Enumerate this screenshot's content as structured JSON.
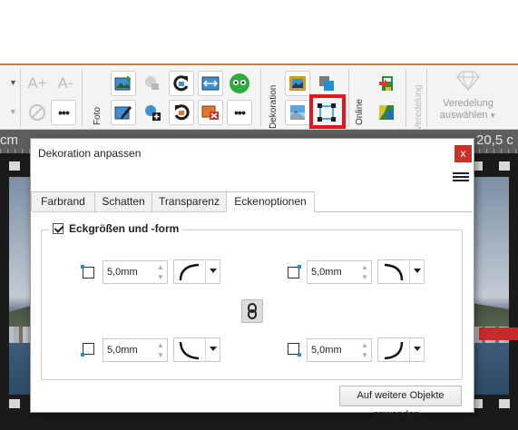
{
  "ribbon": {
    "font_grow": "A+",
    "font_shrink": "A-",
    "more_label": "•••",
    "groups": {
      "foto": "Foto",
      "dekoration": "Dekoration",
      "online": "Online",
      "veredelung": "Veredelung"
    },
    "veredelung_button": {
      "line1": "Veredelung",
      "line2": "auswählen"
    },
    "highlight_color": "#e8141b",
    "accent_color": "#e2762a"
  },
  "ruler": {
    "left_label": "cm",
    "right_label": "20,5 c"
  },
  "dialog": {
    "title": "Dekoration anpassen",
    "close_label": "x",
    "tabs": [
      {
        "label": "Farbrand",
        "active": false
      },
      {
        "label": "Schatten",
        "active": false
      },
      {
        "label": "Transparenz",
        "active": false
      },
      {
        "label": "Eckenoptionen",
        "active": true
      }
    ],
    "group_label": "Eckgrößen und -form",
    "group_checked": true,
    "corners": {
      "top_left": {
        "value": "5,0mm",
        "shape": "round"
      },
      "top_right": {
        "value": "5,0mm",
        "shape": "round"
      },
      "bottom_left": {
        "value": "5,0mm",
        "shape": "round"
      },
      "bottom_right": {
        "value": "5,0mm",
        "shape": "round"
      }
    },
    "apply_button": "Auf weitere Objekte anwenden..."
  },
  "icons": {
    "link": "chain-link-icon",
    "menu": "hamburger-menu-icon",
    "veredelung": "diamond-icon"
  }
}
